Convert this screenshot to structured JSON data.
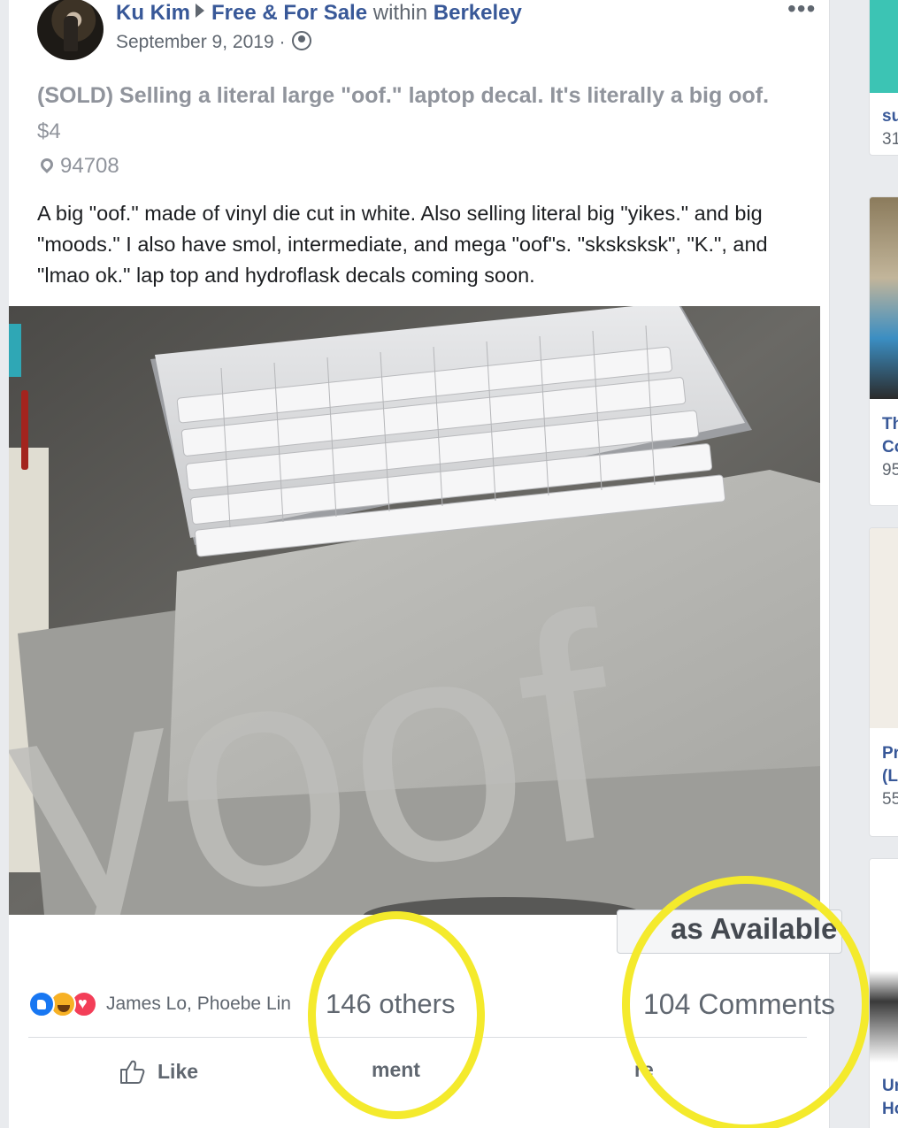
{
  "post": {
    "author": "Ku Kim",
    "group": "Free & For Sale",
    "within_label": "within",
    "location": "Berkeley",
    "date": "September 9, 2019 ·",
    "more_label": "•••",
    "title": "(SOLD) Selling a literal large \"oof.\" laptop decal. It's literally a big oof.",
    "price": "$4",
    "zip": "94708",
    "body": "A big \"oof.\" made of vinyl die cut in white. Also selling literal big \"yikes.\" and big \"moods.\" I also have smol, intermediate, and mega \"oof\"s. \"sksksksk\", \"K.\", and \"lmao ok.\" lap top and hydroflask decals coming soon."
  },
  "photo": {
    "decal_text": "yoof"
  },
  "engagement": {
    "mark_available": "as Available",
    "reaction_names": "James Lo, Phoebe Lin",
    "others": "146 others",
    "comments": "104 Comments",
    "reactions": [
      "like",
      "haha",
      "love"
    ]
  },
  "actions": {
    "like": "Like",
    "comment": "ment",
    "share": "re"
  },
  "right_column": {
    "cards": [
      {
        "title": "su",
        "sub": "31"
      },
      {
        "title": "Th",
        "title2": "Co",
        "sub": "95"
      },
      {
        "title": "Pr",
        "title2": "(L",
        "sub": "55"
      },
      {
        "title": "Ur",
        "title2": "Ho"
      }
    ]
  },
  "colors": {
    "link_blue": "#385898",
    "annotation_yellow": "#f4ea2c",
    "muted_gray": "#90949c"
  }
}
